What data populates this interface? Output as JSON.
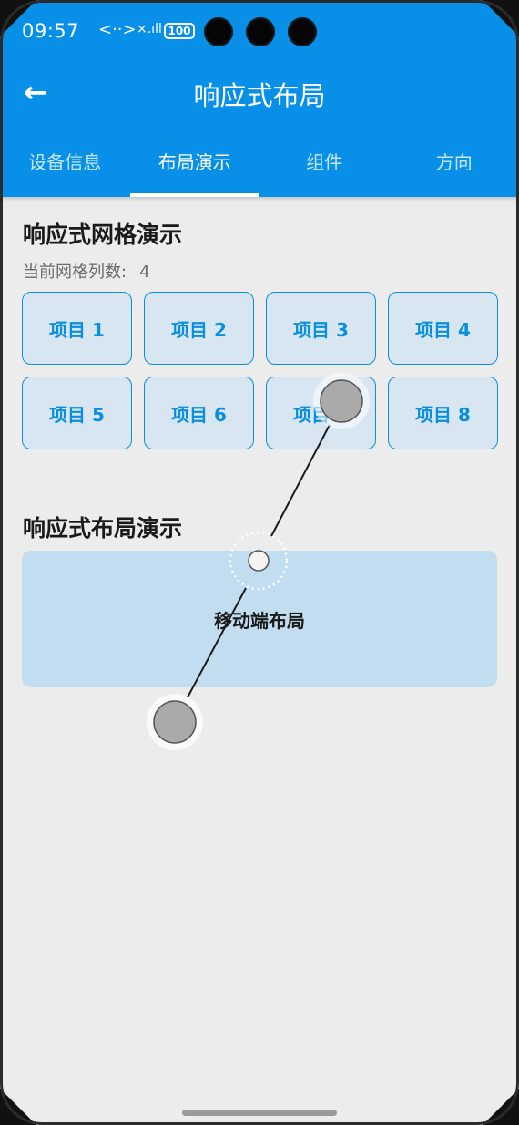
{
  "status_bar": {
    "time": "09:57",
    "net_symbol": "<··>",
    "signal_symbol": "×.ıll",
    "battery": "100"
  },
  "appbar": {
    "back_glyph": "←",
    "title": "响应式布局"
  },
  "tabs": [
    {
      "label": "设备信息",
      "active": false
    },
    {
      "label": "布局演示",
      "active": true
    },
    {
      "label": "组件",
      "active": false
    },
    {
      "label": "方向",
      "active": false
    }
  ],
  "grid_section": {
    "title": "响应式网格演示",
    "columns_label": "当前网格列数:",
    "columns_value": "4",
    "items": [
      "项目 1",
      "项目 2",
      "项目 3",
      "项目 4",
      "项目 5",
      "项目 6",
      "项目 7",
      "项目 8"
    ]
  },
  "layout_section": {
    "title": "响应式布局演示",
    "box_label": "移动端布局"
  },
  "colors": {
    "primary": "#0890e8",
    "item_border": "#0a8fe0",
    "item_bg": "#d7e6f1",
    "layout_bg": "#c1ddef",
    "page_bg": "#ececec"
  }
}
